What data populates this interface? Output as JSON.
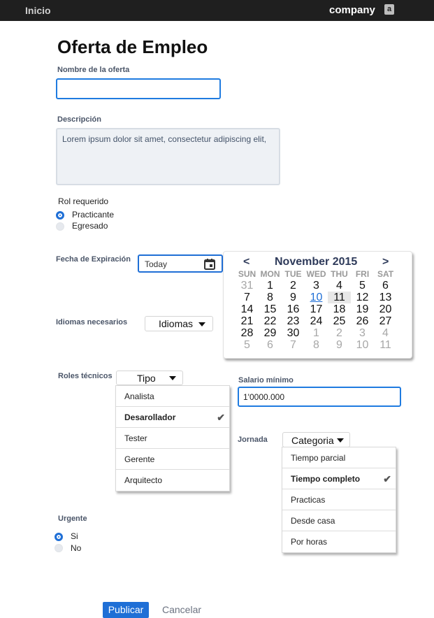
{
  "topbar": {
    "home": "Inicio",
    "brand": "company",
    "app_icon_letter": "a"
  },
  "page_title": "Oferta de Empleo",
  "nombre": {
    "label": "Nombre de la oferta",
    "value": ""
  },
  "descripcion": {
    "label": "Descripción",
    "value": "Lorem ipsum dolor sit amet, consectetur adipiscing elit,"
  },
  "rol": {
    "label": "Rol requerido",
    "options": [
      "Practicante",
      "Egresado"
    ],
    "selected": "Practicante"
  },
  "fecha": {
    "label": "Fecha de Expiración",
    "value": "Today",
    "icon": "calendar-icon"
  },
  "calendar": {
    "prev": "<",
    "next": ">",
    "month_title": "November 2015",
    "dow": [
      "SUN",
      "MON",
      "TUE",
      "WED",
      "THU",
      "FRI",
      "SAT"
    ],
    "weeks": [
      [
        "31",
        "1",
        "2",
        "3",
        "4",
        "5",
        "6"
      ],
      [
        "7",
        "8",
        "9",
        "10",
        "11",
        "12",
        "13"
      ],
      [
        "14",
        "15",
        "16",
        "17",
        "18",
        "19",
        "20"
      ],
      [
        "21",
        "22",
        "23",
        "24",
        "25",
        "26",
        "27"
      ],
      [
        "28",
        "29",
        "30",
        "1",
        "2",
        "3",
        "4"
      ],
      [
        "5",
        "6",
        "7",
        "8",
        "9",
        "10",
        "11"
      ]
    ],
    "today": "10",
    "selected": "11"
  },
  "idiomas": {
    "label": "Idiomas necesarios",
    "button": "Idiomas"
  },
  "roles": {
    "label": "Roles técnicos",
    "button": "Tipo",
    "items": [
      "Analista",
      "Desarollador",
      "Tester",
      "Gerente",
      "Arquitecto"
    ],
    "selected": "Desarollador",
    "check": "✔"
  },
  "salario": {
    "label": "Salario mínimo",
    "value": "1'0000.000"
  },
  "jornada": {
    "label": "Jornada",
    "button": "Categoria",
    "items": [
      "Tiempo parcial",
      "Tiempo completo",
      "Practicas",
      "Desde casa",
      "Por horas"
    ],
    "selected": "Tiempo completo",
    "check": "✔"
  },
  "urgente": {
    "label": "Urgente",
    "options": [
      "Si",
      "No"
    ],
    "selected": "Si"
  },
  "actions": {
    "publish": "Publicar",
    "cancel": "Cancelar"
  },
  "colors": {
    "accent": "#1f6fd6",
    "topbar": "#1f1f1f"
  }
}
